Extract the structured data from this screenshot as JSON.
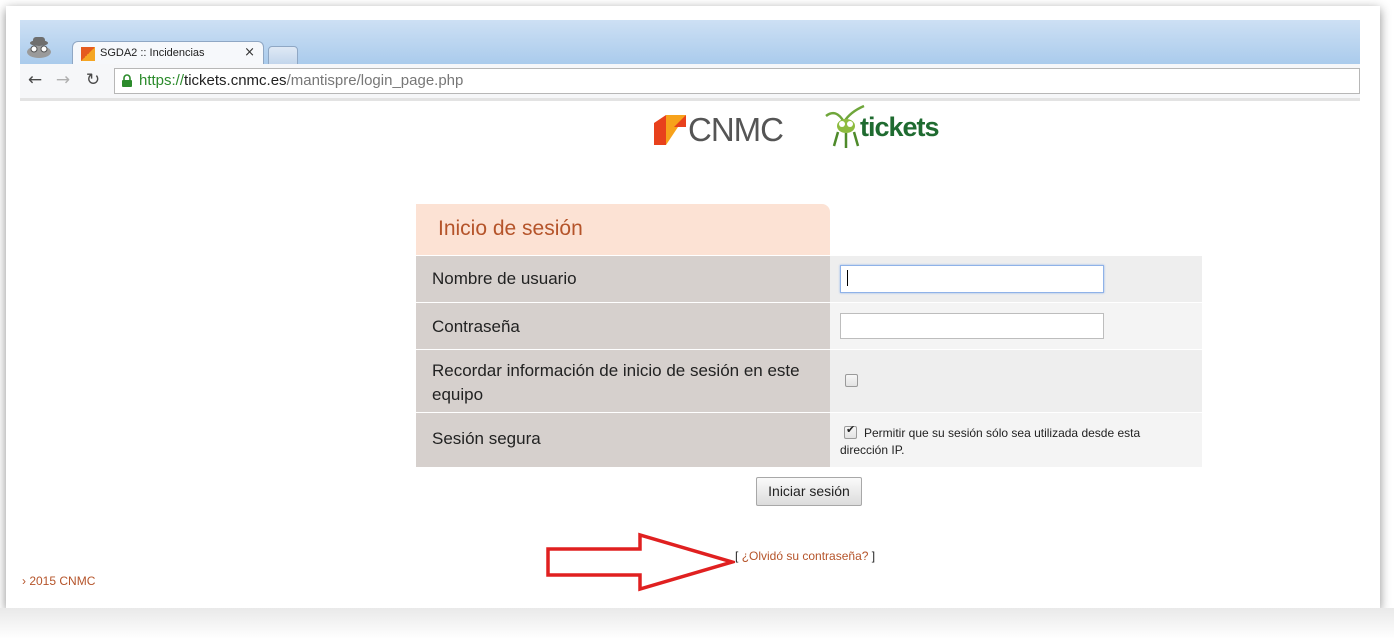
{
  "browser": {
    "tab_title": "SGDA2 :: Incidencias",
    "tab_close": "×",
    "url_scheme": "https://",
    "url_host": "tickets.cnmc.es",
    "url_path": "/mantispre/login_page.php"
  },
  "logos": {
    "cnmc": "CNMC",
    "tickets": "tickets"
  },
  "login": {
    "title": "Inicio de sesión",
    "username_label": "Nombre de usuario",
    "username_value": "",
    "password_label": "Contraseña",
    "password_value": "",
    "remember_label": "Recordar información de inicio de sesión en este equipo",
    "remember_checked": false,
    "secure_label": "Sesión segura",
    "secure_checked": true,
    "secure_description": "Permitir que su sesión sólo sea utilizada desde esta dirección IP.",
    "submit_label": "Iniciar sesión",
    "forgot_open": "[",
    "forgot_link": "¿Olvidó su contraseña?",
    "forgot_close": "]"
  },
  "footer": {
    "copyright": "› 2015 CNMC"
  },
  "colors": {
    "accent": "#b5542a",
    "header_bg": "#fce2d4",
    "label_bg": "#d6d0cd",
    "arrow": "#e02020"
  }
}
